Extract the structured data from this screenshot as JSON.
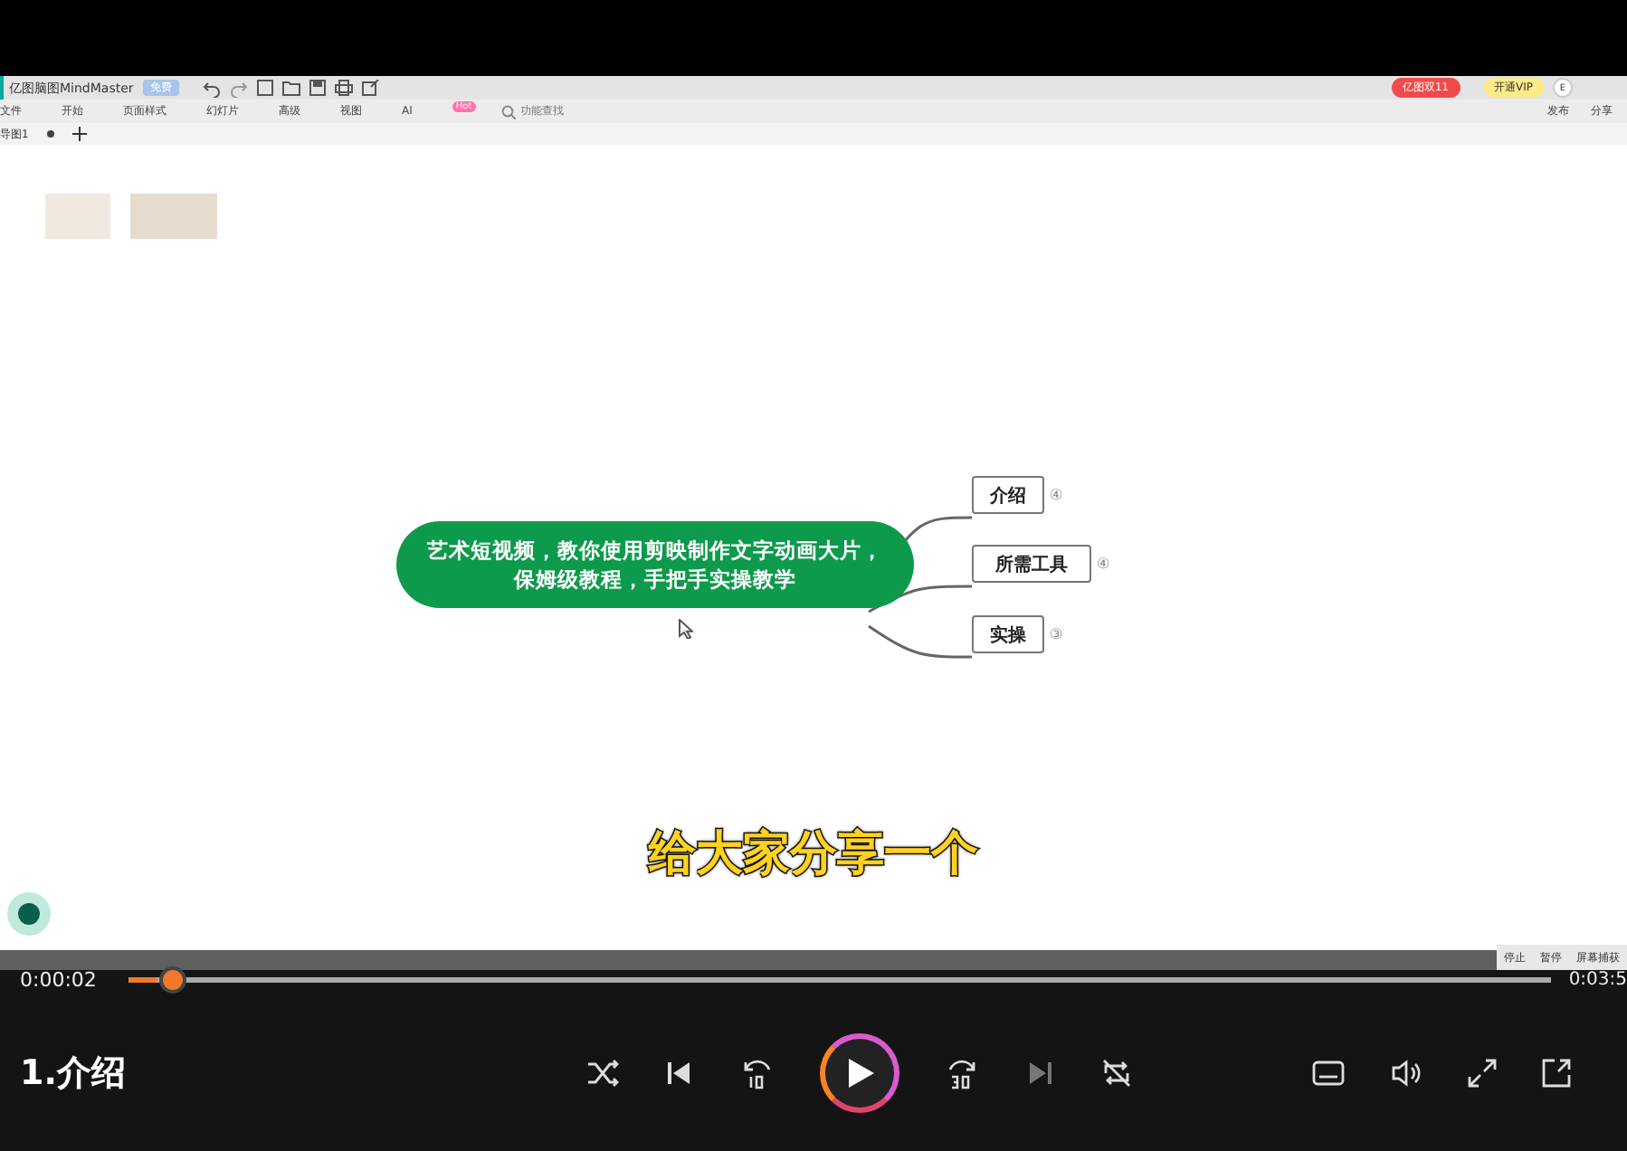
{
  "app": {
    "title": "亿图脑图MindMaster",
    "title_badge": "免费",
    "menu": [
      "文件",
      "开始",
      "页面样式",
      "幻灯片",
      "高级",
      "视图",
      "AI"
    ],
    "ai_badge": "Hot",
    "search": {
      "placeholder": "功能查找"
    },
    "promo": "亿图双11",
    "vip": "开通VIP",
    "avatar": "E",
    "actions": [
      "发布",
      "分享"
    ],
    "tabs": [
      {
        "label": "导图1",
        "selected": true
      }
    ]
  },
  "mindmap": {
    "root": "艺术短视频，教你使用剪映制作文字动画大片，保姆级教程，手把手实操教学",
    "children": [
      {
        "label": "介绍",
        "count": "④"
      },
      {
        "label": "所需工具",
        "count": "④"
      },
      {
        "label": "实操",
        "count": "③"
      }
    ]
  },
  "subtitle": "给大家分享一个",
  "recorder": [
    "停止",
    "暂停",
    "屏幕捕获"
  ],
  "player": {
    "current_time": "0:00:02",
    "total_time": "0:03:5",
    "progress": {
      "level": 0.02
    },
    "title": "1.介绍"
  }
}
